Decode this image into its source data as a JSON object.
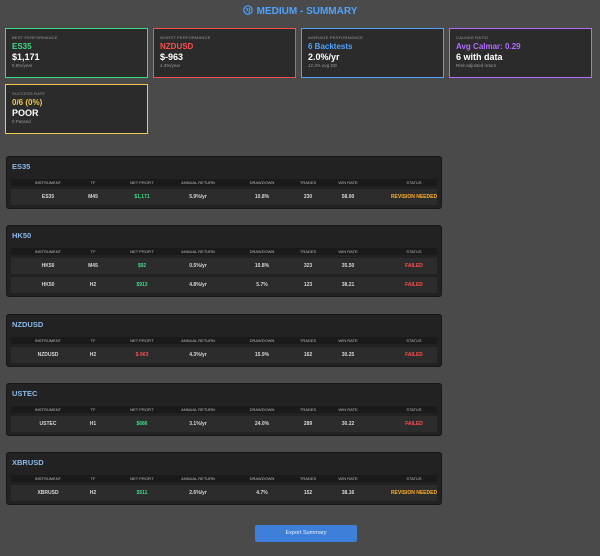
{
  "header": {
    "title": "MEDIUM - SUMMARY",
    "icon": "globe-icon"
  },
  "cards": [
    {
      "label": "BEST PERFORMANCE",
      "v1": "ES35",
      "v2": "$1,171",
      "sub": "5.9%/year",
      "color": "#3ddc84"
    },
    {
      "label": "WORST PERFORMANCE",
      "v1": "NZDUSD",
      "v2": "$-963",
      "sub": "4.3%/year",
      "color": "#ff4d4d"
    },
    {
      "label": "AVERAGE PERFORMANCE",
      "v1": "6 Backtests",
      "v2": "2.0%/yr",
      "sub": "12.3% avg DD",
      "color": "#4da3ff"
    },
    {
      "label": "CALMAR RATIO",
      "v1": "Avg Calmar: 0.29",
      "v2": "6 with data",
      "sub": "Risk-adjusted return",
      "color": "#b36bff"
    },
    {
      "label": "SUCCESS RATE",
      "v1": "0/6 (0%)",
      "v2": "POOR",
      "sub": "0 Passed",
      "color": "#f2c94c"
    }
  ],
  "table_headers": [
    "INSTRUMENT",
    "TF",
    "NET PROFIT",
    "ANNUAL RETURN",
    "DRAWDOWN",
    "TRADES",
    "WIN RATE",
    "STATUS"
  ],
  "sections": [
    {
      "name": "ES35",
      "rows": [
        {
          "instrument": "ES35",
          "tf": "M45",
          "profit": "$1,171",
          "profit_sign": "pos",
          "annual": "5.9%/yr",
          "drawdown": "10.8%",
          "trades": "230",
          "winrate": "58.00",
          "status": "REVISION NEEDED",
          "status_type": "revision"
        }
      ]
    },
    {
      "name": "HK50",
      "rows": [
        {
          "instrument": "HK50",
          "tf": "M45",
          "profit": "$92",
          "profit_sign": "pos",
          "annual": "0.5%/yr",
          "drawdown": "10.8%",
          "trades": "323",
          "winrate": "35.50",
          "status": "FAILED",
          "status_type": "failed"
        },
        {
          "instrument": "HK50",
          "tf": "H2",
          "profit": "$913",
          "profit_sign": "pos",
          "annual": "4.8%/yr",
          "drawdown": "5.7%",
          "trades": "123",
          "winrate": "38.21",
          "status": "FAILED",
          "status_type": "failed"
        }
      ]
    },
    {
      "name": "NZDUSD",
      "rows": [
        {
          "instrument": "NZDUSD",
          "tf": "H2",
          "profit": "$-963",
          "profit_sign": "neg",
          "annual": "4.3%/yr",
          "drawdown": "15.9%",
          "trades": "162",
          "winrate": "30.25",
          "status": "FAILED",
          "status_type": "failed"
        }
      ]
    },
    {
      "name": "USTEC",
      "rows": [
        {
          "instrument": "USTEC",
          "tf": "H1",
          "profit": "$686",
          "profit_sign": "pos",
          "annual": "3.1%/yr",
          "drawdown": "24.0%",
          "trades": "289",
          "winrate": "30.22",
          "status": "FAILED",
          "status_type": "failed"
        }
      ]
    },
    {
      "name": "XBRUSD",
      "rows": [
        {
          "instrument": "XBRUSD",
          "tf": "H2",
          "profit": "$511",
          "profit_sign": "pos",
          "annual": "2.6%/yr",
          "drawdown": "4.7%",
          "trades": "152",
          "winrate": "38.16",
          "status": "REVISION NEEDED",
          "status_type": "revision"
        }
      ]
    }
  ],
  "export_label": "Export Summary"
}
